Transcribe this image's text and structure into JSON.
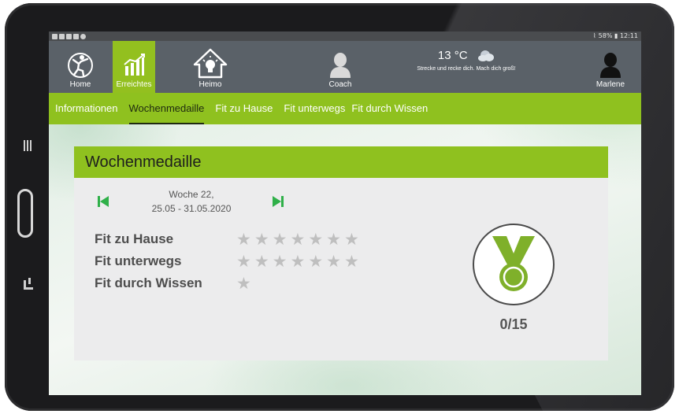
{
  "statusbar": {
    "right": "58% ▮ 12:11"
  },
  "nav": {
    "items": [
      {
        "label": "Home",
        "icon": "home-figure-icon"
      },
      {
        "label": "Erreichtes",
        "icon": "chart-bars-icon",
        "active": true
      },
      {
        "label": "Heimo",
        "icon": "lightbulb-house-icon"
      },
      {
        "label": "Coach",
        "icon": "person-icon"
      },
      {
        "label": "Marlene",
        "icon": "user-icon"
      }
    ]
  },
  "weather": {
    "temp": "13 °C",
    "icon": "cloud-icon",
    "text": "Strecke und recke dich. Mach dich groß!"
  },
  "tabs": [
    {
      "label": "Informationen"
    },
    {
      "label": "Wochenmedaille",
      "active": true
    },
    {
      "label": "Fit zu Hause"
    },
    {
      "label": "Fit unterwegs"
    },
    {
      "label": "Fit durch Wissen"
    }
  ],
  "card": {
    "title": "Wochenmedaille",
    "week_line1": "Woche 22,",
    "week_line2": "25.05 - 31.05.2020",
    "categories": [
      {
        "label": "Fit zu Hause",
        "stars": 7,
        "earned": 0
      },
      {
        "label": "Fit unterwegs",
        "stars": 7,
        "earned": 0
      },
      {
        "label": "Fit durch Wissen",
        "stars": 1,
        "earned": 0
      }
    ],
    "score": "0/15"
  },
  "colors": {
    "accent": "#8fc11f",
    "nav_bg": "#5a6168",
    "medal": "#7fb02a",
    "star_empty": "#bfbfbf"
  }
}
